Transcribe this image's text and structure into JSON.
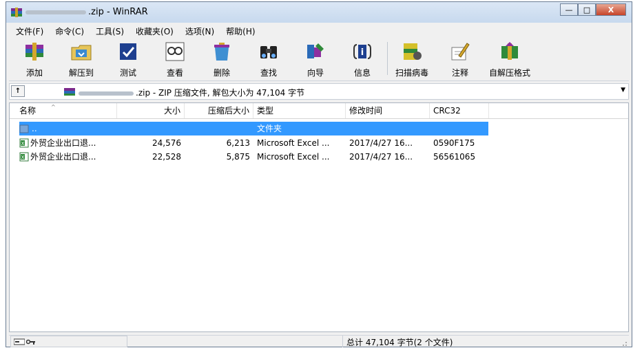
{
  "window": {
    "title_suffix": ".zip - WinRAR",
    "controls": {
      "minimize": "—",
      "maximize": "□",
      "close": "X"
    }
  },
  "menu": [
    "文件(F)",
    "命令(C)",
    "工具(S)",
    "收藏夹(O)",
    "选项(N)",
    "帮助(H)"
  ],
  "toolbar": {
    "add": "添加",
    "extract_to": "解压到",
    "test": "测试",
    "view": "查看",
    "delete": "删除",
    "find": "查找",
    "wizard": "向导",
    "info": "信息",
    "virus_scan": "扫描病毒",
    "comment": "注释",
    "sfx": "自解压格式"
  },
  "address": {
    "up_label": "↑",
    "text": ".zip - ZIP 压缩文件, 解包大小为 47,104 字节"
  },
  "columns": {
    "name": "名称",
    "size": "大小",
    "packed": "压缩后大小",
    "type": "类型",
    "modified": "修改时间",
    "crc": "CRC32"
  },
  "rows": [
    {
      "name": "..",
      "size": "",
      "packed": "",
      "type": "文件夹",
      "modified": "",
      "crc": ""
    },
    {
      "name": "外贸企业出口退...",
      "size": "24,576",
      "packed": "6,213",
      "type": "Microsoft Excel ...",
      "modified": "2017/4/27 16...",
      "crc": "0590F175"
    },
    {
      "name": "外贸企业出口退...",
      "size": "22,528",
      "packed": "5,875",
      "type": "Microsoft Excel ...",
      "modified": "2017/4/27 16...",
      "crc": "56561065"
    }
  ],
  "status": {
    "summary": "总计 47,104 字节(2 个文件)"
  },
  "colors": {
    "selection": "#3399ff",
    "titlebar": "#c7d9ee",
    "close_button": "#c7442a"
  }
}
